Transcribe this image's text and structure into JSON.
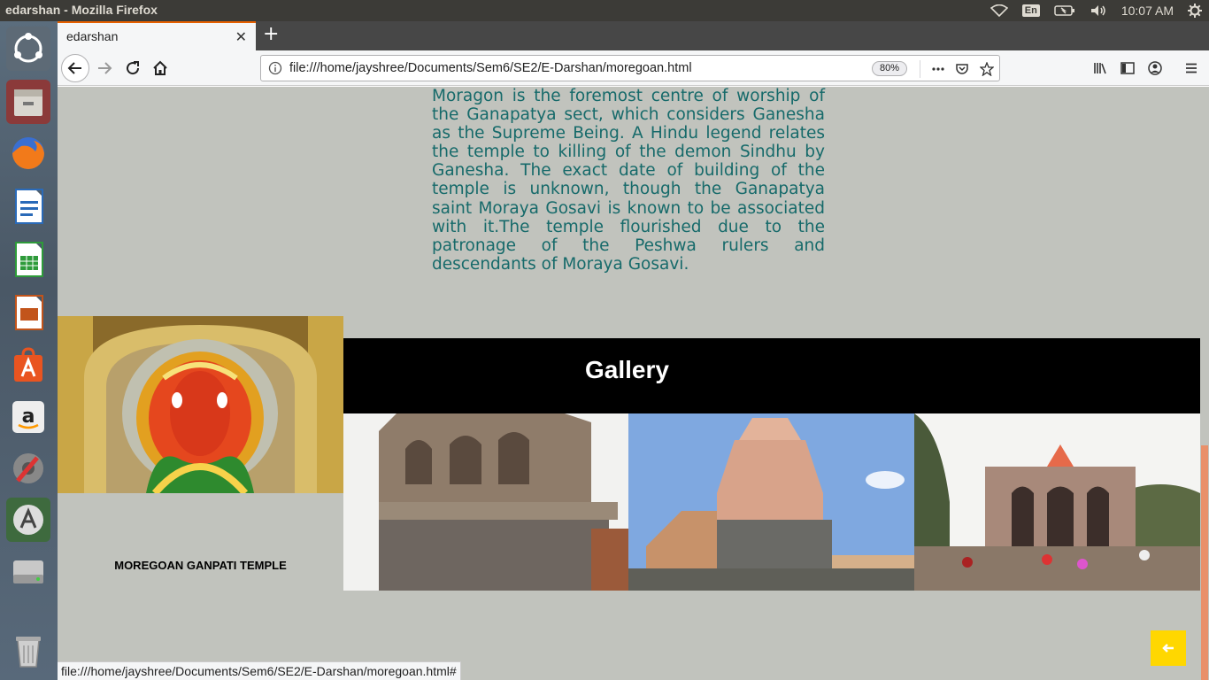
{
  "panel": {
    "window_title": "edarshan - Mozilla Firefox",
    "keyboard_layout": "En",
    "clock": "10:07 AM"
  },
  "launcher": {
    "items": [
      "dash-home",
      "files",
      "firefox",
      "libreoffice-writer",
      "libreoffice-calc",
      "libreoffice-impress",
      "ubuntu-software",
      "amazon",
      "system-settings",
      "software-updater",
      "disk",
      "trash"
    ]
  },
  "browser": {
    "tab_title": "edarshan",
    "url": "file:///home/jayshree/Documents/Sem6/SE2/E-Darshan/moregoan.html",
    "zoom": "80%"
  },
  "page": {
    "description": "Moragon is the foremost centre of worship of the Ganapatya sect, which considers Ganesha as the Supreme Being. A Hindu legend relates the temple to killing of the demon Sindhu by Ganesha. The exact date of building of the temple is unknown, though the Ganapatya saint Moraya Gosavi is known to be associated with it.The temple flourished due to the patronage of the Peshwa rulers and descendants of Moraya Gosavi.",
    "temple_caption": "MOREGOAN GANPATI TEMPLE",
    "gallery_title": "Gallery"
  },
  "status_bar": "file:///home/jayshree/Documents/Sem6/SE2/E-Darshan/moregoan.html#",
  "colors": {
    "page_background": "#c1c3bd",
    "description_text": "#166a6a",
    "gallery_header": "#000000",
    "back_to_top": "#ffd700",
    "tab_accent": "#e66000"
  }
}
